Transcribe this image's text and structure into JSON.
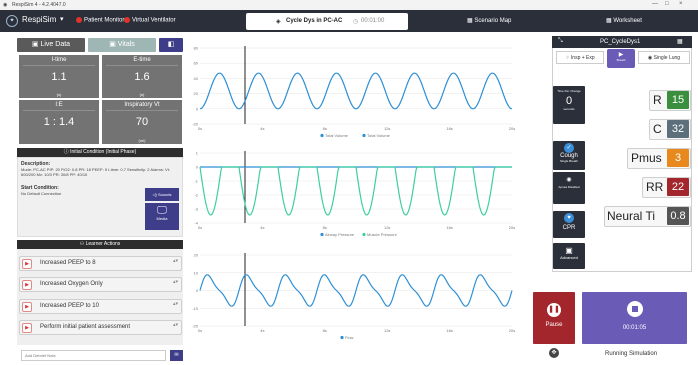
{
  "window": {
    "title": "RespiSim 4 - 4.2.4047.0",
    "controls": [
      "—",
      "□",
      "×"
    ]
  },
  "nav": {
    "brand": "RespiSim",
    "brand_caret": "▾",
    "patient_monitor": "Patient Monitor",
    "virtual_ventilator": "Virtual Ventilator",
    "scenario_title": "Cycle Dys in PC-AC",
    "scenario_timer": "00:01:00",
    "scenario_map": "Scenario Map",
    "worksheet": "Worksheet"
  },
  "left": {
    "tabs": {
      "live_data": "Live Data",
      "vitals": "Vitals"
    },
    "cells": [
      {
        "label": "I-time",
        "value": "1.1",
        "unit": "(s)"
      },
      {
        "label": "E-time",
        "value": "1.6",
        "unit": "(s)"
      },
      {
        "label": "I:E",
        "value": "1 : 1.4",
        "unit": ""
      },
      {
        "label": "Inspiratory Vt",
        "value": "70",
        "unit": "(ml)"
      }
    ],
    "initial_condition_header": "Initial Condition (Initial Phase)",
    "description_title": "Description:",
    "description_text": "Mode: PC-AC PIP: 20 FiO2: 0.8 PR: 18 PEEP: 5 I-time: 0.7 Sensitivity: 2 Alarms: Vt: 600/200 Mv: 10/3 PR: 30/8 PP: 40/10",
    "start_condition_title": "Start Condition:",
    "start_condition_text": "No Default Connection",
    "sounds_label": "Sounds",
    "media_label": "Media",
    "learner_actions_header": "Learner Actions",
    "actions": [
      "Increased PEEP to 8",
      "Increased Oxygen Only",
      "Increased PEEP to 10",
      "Perform initial patient assessment"
    ],
    "debrief_placeholder": "Add Debrief Note"
  },
  "charts": [
    {
      "name": "volume-chart",
      "y_ticks": [
        "80",
        "60",
        "40",
        "20",
        "0",
        "-20"
      ],
      "x_ticks": [
        "0s",
        "4s",
        "8s",
        "12s",
        "16s",
        "20s"
      ],
      "legend": [
        "Total Volume",
        "Total Volume"
      ]
    },
    {
      "name": "pressure-chart",
      "y_ticks": [
        "1",
        "0",
        "-1",
        "-2",
        "-3",
        "-4"
      ],
      "x_ticks": [
        "0s",
        "4s",
        "8s",
        "12s",
        "16s",
        "20s"
      ],
      "legend": [
        "Airway Pressure",
        "Muscle Pressure"
      ]
    },
    {
      "name": "flow-chart",
      "y_ticks": [
        "20",
        "10",
        "0",
        "-10",
        "-20"
      ],
      "x_ticks": [
        "0s",
        "4s",
        "8s",
        "12s",
        "16s",
        "20s"
      ],
      "legend": [
        "Flow"
      ]
    }
  ],
  "colors": {
    "blue": "#2d8fd5",
    "green": "#3dcfa0",
    "nav": "#2a2f3a",
    "pause": "#a3262d",
    "sim": "#6a5bb6"
  },
  "right": {
    "patient_name": "PC_CycleDys1",
    "modes": {
      "insp_exp": "Insp + Exp",
      "single_lung": "Single Lung",
      "breath_label": "Breath"
    },
    "time_per_change": {
      "label": "Time Per Change",
      "value": "0",
      "unit": "seconds"
    },
    "side": {
      "cough": "Cough",
      "cough_sub": "Single Breath",
      "apnea": "Apnea Disabled",
      "cpr": "CPR",
      "advanced": "Advanced"
    },
    "params": [
      {
        "label": "R",
        "value": "15",
        "color": "#3a8f3e"
      },
      {
        "label": "C",
        "value": "32",
        "color": "#5d6f7b"
      },
      {
        "label": "Pmus",
        "value": "3",
        "color": "#e7891d"
      },
      {
        "label": "RR",
        "value": "22",
        "color": "#a3262d"
      },
      {
        "label": "Neural Ti",
        "value": "0.8",
        "color": "#555555"
      }
    ],
    "pause_label": "Pause",
    "sim_time": "00:01:05",
    "running_label": "Running Simulation"
  }
}
